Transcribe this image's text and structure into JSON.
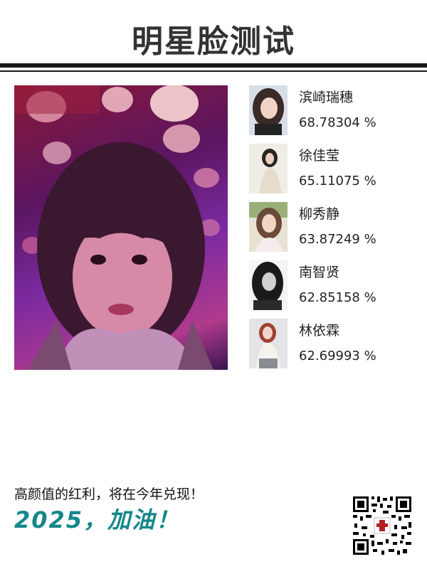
{
  "header": {
    "title": "明星脸测试"
  },
  "matches": [
    {
      "name": "滨崎瑞穗",
      "score": "68.78304 %"
    },
    {
      "name": "徐佳莹",
      "score": "65.11075 %"
    },
    {
      "name": "柳秀静",
      "score": "63.87249 %"
    },
    {
      "name": "南智贤",
      "score": "62.85158 %"
    },
    {
      "name": "林依霖",
      "score": "62.69993 %"
    }
  ],
  "footer": {
    "slogan": "高颜值的红利，将在今年兑现！",
    "headline": "2025，加油！"
  },
  "colors": {
    "accent": "#15878a",
    "rule": "#1a1a1a"
  }
}
